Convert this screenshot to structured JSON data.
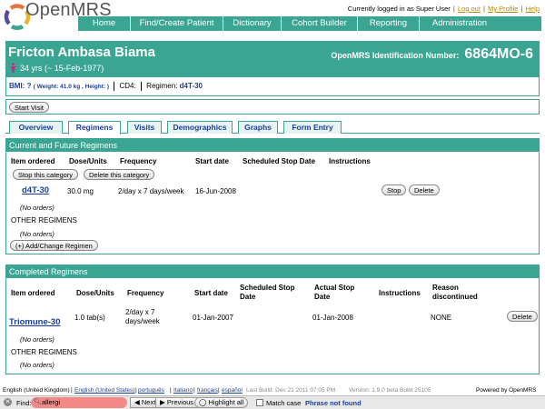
{
  "app": {
    "logo_text": "OpenMRS"
  },
  "userbar": {
    "status": "Currently logged in as Super User",
    "logout": "Log out",
    "my_profile": "My Profile",
    "help": "Help"
  },
  "nav": [
    "Home",
    "Find/Create Patient",
    "Dictionary",
    "Cohort Builder",
    "Reporting",
    "Administration"
  ],
  "patient": {
    "name": "Fricton Ambasa Biama",
    "age": "34 yrs (~ 15-Feb-1977)",
    "id_label": "OpenMRS Identification Number:",
    "id_value": "6864MO-6",
    "bmi_label": "BMI:",
    "bmi_value": "?",
    "bmi_detail": "( Weight: 41.0 kg , Height: )",
    "cd4_label": "CD4:",
    "regimen_label": "Regimen:",
    "regimen_value": "d4T-30"
  },
  "start_visit": "Start Visit",
  "tabs": [
    "Overview",
    "Regimens",
    "Visits",
    "Demographics",
    "Graphs",
    "Form Entry"
  ],
  "current": {
    "title": "Current and Future Regimens",
    "headers": {
      "item": "Item ordered",
      "dose": "Dose/Units",
      "freq": "Frequency",
      "start": "Start date",
      "sched": "Scheduled Stop Date",
      "instr": "Instructions"
    },
    "stop_category": "Stop this category",
    "delete_category": "Delete this category",
    "row": {
      "drug": "d4T-30",
      "dose": "30.0 mg",
      "freq": "2/day x 7 days/week",
      "start": "16-Jun-2008",
      "stop_btn": "Stop",
      "delete_btn": "Delete"
    },
    "no_orders_1": "(No orders)",
    "other_regimens": "OTHER REGIMENS",
    "no_orders_2": "(No orders)",
    "add_change": "(+) Add/Change Regimen"
  },
  "completed": {
    "title": "Completed Regimens",
    "headers": {
      "item": "Item ordered",
      "dose": "Dose/Units",
      "freq": "Frequency",
      "start": "Start date",
      "sched_1": "Scheduled Stop",
      "sched_2": "Date",
      "actual_1": "Actual Stop",
      "actual_2": "Date",
      "instr": "Instructions",
      "reason_1": "Reason",
      "reason_2": "discontinued"
    },
    "row": {
      "drug": "Triomune-30",
      "dose": "1.0 tab(s)",
      "freq_1": "2/day x 7",
      "freq_2": "days/week",
      "start": "01-Jan-2007",
      "actual": "01-Jan-2008",
      "reason": "NONE",
      "delete_btn": "Delete"
    },
    "no_orders_1": "(No orders)",
    "other_regimens": "OTHER REGIMENS",
    "no_orders_2": "(No orders)"
  },
  "footer": {
    "langs": [
      "English (United Kingdom)",
      "English (United States)",
      "português",
      "Italiano",
      "français",
      "español"
    ],
    "build": "Last Build: Dec 21 2011 07:05 PM",
    "version": "Version: 1.9.0 beta Build 25105",
    "powered": "Powered by OpenMRS"
  },
  "findbar": {
    "label": "Find:",
    "query": "allergi",
    "next": "Next",
    "previous": "Previous",
    "highlight": "Highlight all",
    "match_case": "Match case",
    "status": "Phrase not found"
  },
  "colors": {
    "teal": "#3aa592",
    "link": "#1a3f99",
    "find_error": "#f28a8a"
  }
}
